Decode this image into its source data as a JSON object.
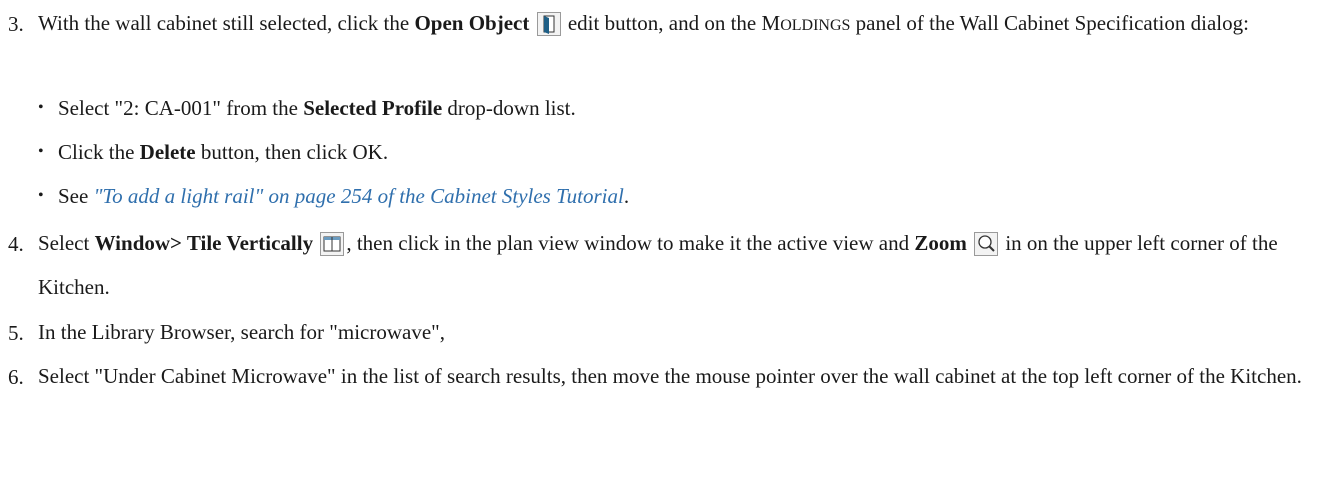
{
  "step3": {
    "number": "3.",
    "p1": "With the wall cabinet still selected, click the ",
    "open_object": "Open Object",
    "p2": " edit button, and on the ",
    "moldings_first": "M",
    "moldings_rest": "OLDINGS",
    "p3": " panel of the Wall Cabinet Specification dialog:"
  },
  "bullets": [
    {
      "pre": "Select \"2: CA-001\" from the ",
      "bold": "Selected Profile",
      "post": " drop-down list."
    },
    {
      "pre": "Click the ",
      "bold": "Delete",
      "post": " button, then click OK."
    },
    {
      "pre": "See ",
      "link": "\"To add a light rail\" on page 254 of the Cabinet Styles Tutorial",
      "post": "."
    }
  ],
  "step4": {
    "number": "4.",
    "bold_window": "Window> Tile Vertically",
    "p0": "Select ",
    "p1": ", then click in the plan view window to make it the active view and ",
    "bold_zoom": "Zoom",
    "p2": " in on the upper left corner of the Kitchen."
  },
  "step5": {
    "number": "5.",
    "text": "In the Library Browser, search for \"microwave\","
  },
  "step6": {
    "number": "6.",
    "text": "Select \"Under Cabinet Microwave\" in the list of search results, then move the mouse pointer over the wall cabinet at the top left corner of the Kitchen."
  },
  "icons": {
    "open_object": "open-object-icon",
    "tile_vertically": "tile-vertically-icon",
    "zoom": "zoom-icon"
  },
  "colors": {
    "link": "#2f6fad",
    "icon_accent": "#1f5f86"
  }
}
